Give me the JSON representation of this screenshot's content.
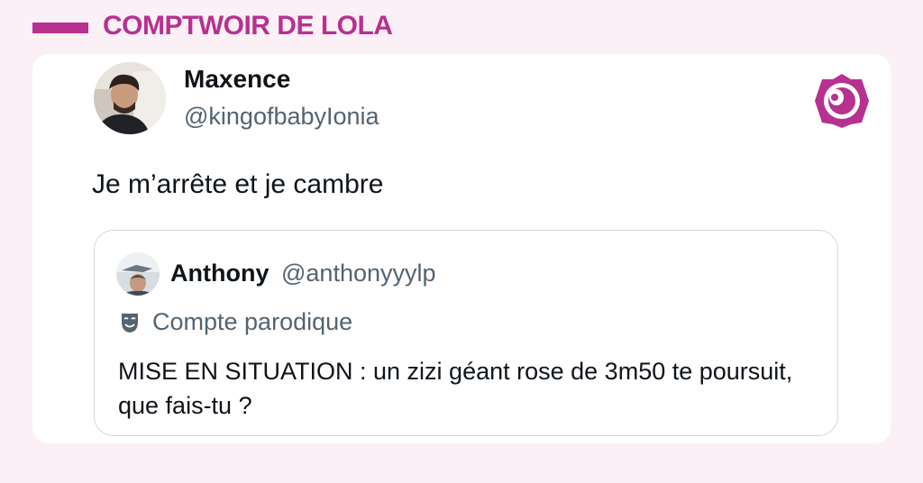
{
  "brand": {
    "name": "COMPTWOIR DE LOLA",
    "accent_color": "#b7318f"
  },
  "tweet": {
    "author_name": "Maxence",
    "author_handle": "@kingofbabyIonia",
    "text": "Je m’arrête et je cambre",
    "avatar_icon": "user-avatar"
  },
  "quoted_tweet": {
    "author_name": "Anthony",
    "author_handle": "@anthonyyylp",
    "badge_label": "Compte parodique",
    "badge_icon": "theater-mask-icon",
    "text": "MISE EN SITUATION : un zizi géant rose de 3m50 te poursuit, que fais-tu ?"
  }
}
